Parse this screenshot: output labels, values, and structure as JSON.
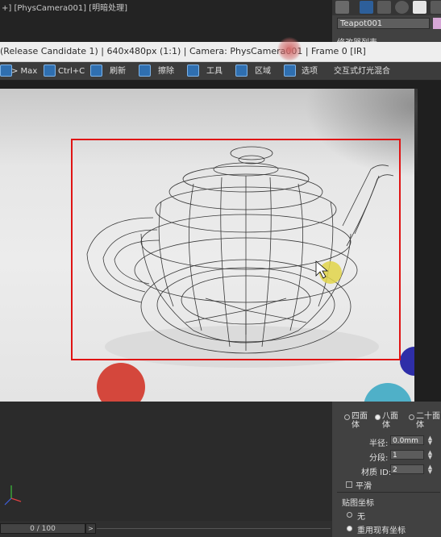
{
  "viewport": {
    "label": "+] [PhysCamera001] [明暗处理]"
  },
  "render_window": {
    "title": "(Release Candidate 1) | 640x480px (1:1) | Camera: PhysCamera001 | Frame 0 [IR]",
    "toolbar": {
      "max_label": "> Max",
      "copy_label": "Ctrl+C",
      "refresh_label": "刷新",
      "clear_label": "擦除",
      "tools_label": "工具",
      "region_label": "区域",
      "options_label": "选项",
      "interactive_label": "交互式灯光混合"
    }
  },
  "command_panel": {
    "object_name": "Teapot001",
    "object_color": "#d6a7d6",
    "sub_label": "修改器列表",
    "segments": {
      "option1": "四面体",
      "option2": "八面体",
      "option3": "二十面体",
      "selected": "八面体"
    },
    "radius_label": "半径:",
    "radius_value": "0.0mm",
    "segments_label": "分段:",
    "segments_value": "1",
    "material_id_label": "材质 ID:",
    "material_id_value": "2",
    "smooth_label": "平滑",
    "mapping_title": "贴图坐标",
    "mapping_none": "无",
    "mapping_existing": "重用现有坐标"
  },
  "timeline": {
    "slider_text": "0 / 100",
    "next_label": ">"
  },
  "colors": {
    "selection_box": "#e01414",
    "accent": "#2f6fb0"
  }
}
